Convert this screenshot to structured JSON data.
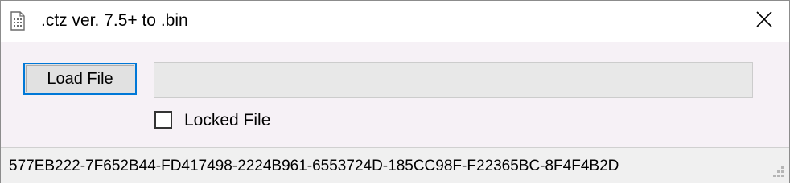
{
  "window": {
    "title": ".ctz ver. 7.5+ to .bin",
    "app_icon": "document-icon",
    "close_icon": "close-icon"
  },
  "main": {
    "load_button_label": "Load File",
    "file_path_value": "",
    "locked_checkbox": {
      "label": "Locked File",
      "checked": false
    }
  },
  "status_bar": {
    "text": "577EB222-7F652B44-FD417498-2224B961-6553724D-185CC98F-F22365BC-8F4F4B2D"
  },
  "colors": {
    "accent": "#0078d7",
    "window_bg": "#f6f1f6",
    "button_bg": "#e1e1e1",
    "field_bg": "#e8e8e8"
  }
}
